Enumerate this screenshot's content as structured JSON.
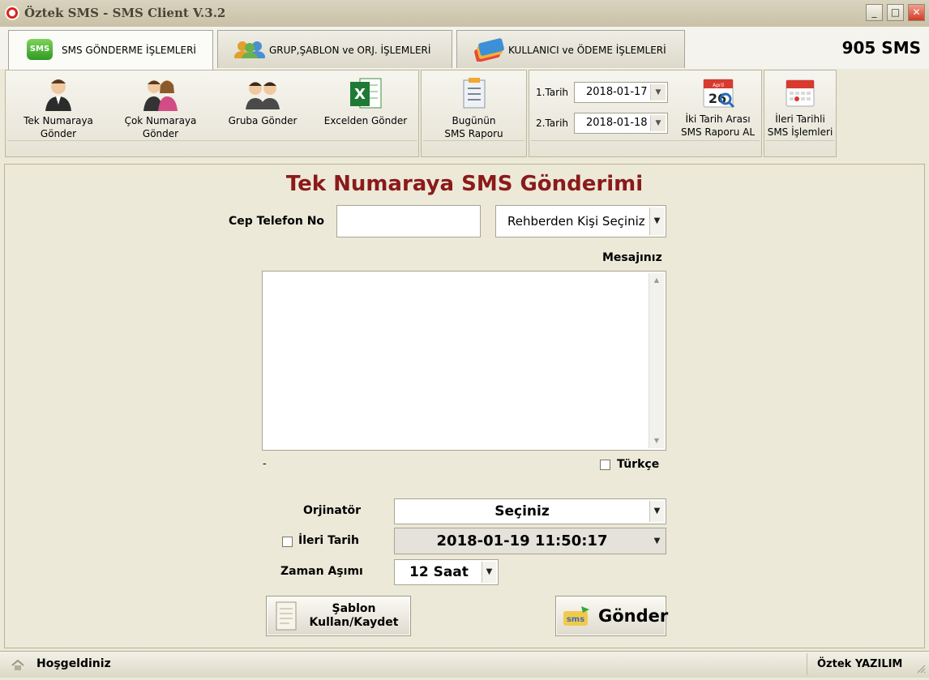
{
  "window": {
    "title": "Öztek SMS - SMS Client  V.3.2",
    "minimize": "_",
    "maximize": "□",
    "close": "✕"
  },
  "tabs": [
    {
      "label": "SMS GÖNDERME İŞLEMLERİ",
      "icon": "sms-bubble-icon"
    },
    {
      "label": "GRUP,ŞABLON ve ORJ. İŞLEMLERİ",
      "icon": "users-group-icon"
    },
    {
      "label": "KULLANICI ve ÖDEME İŞLEMLERİ",
      "icon": "credit-cards-icon"
    }
  ],
  "sms_balance": "905 SMS",
  "ribbon": {
    "send_buttons": [
      {
        "line1": "Tek Numaraya",
        "line2": "Gönder"
      },
      {
        "line1": "Çok Numaraya",
        "line2": "Gönder"
      },
      {
        "line1": "Gruba Gönder",
        "line2": ""
      },
      {
        "line1": "Excelden Gönder",
        "line2": ""
      }
    ],
    "today_report": {
      "line1": "Bugünün",
      "line2": "SMS Raporu"
    },
    "date1_label": "1.Tarih",
    "date1_value": "2018-01-17",
    "date2_label": "2.Tarih",
    "date2_value": "2018-01-18",
    "range_report": {
      "line1": "İki Tarih Arası",
      "line2": "SMS Raporu AL",
      "calendar_day": "26",
      "calendar_month": "April"
    },
    "scheduled": {
      "line1": "İleri Tarihli",
      "line2": "SMS İşlemleri"
    }
  },
  "form": {
    "title": "Tek Numaraya SMS Gönderimi",
    "phone_label": "Cep Telefon No",
    "phone_value": "",
    "contact_select": "Rehberden Kişi Seçiniz",
    "message_label": "Mesajınız",
    "message_value": "",
    "char_counter": "-",
    "turkish_label": "Türkçe",
    "turkish_checked": false,
    "originator_label": "Orjinatör",
    "originator_value": "Seçiniz",
    "future_date_label": "İleri Tarih",
    "future_date_checked": false,
    "future_date_value": "2018-01-19 11:50:17",
    "timeout_label": "Zaman Aşımı",
    "timeout_value": "12 Saat",
    "template_button": {
      "line1": "Şablon",
      "line2": "Kullan/Kaydet"
    },
    "send_button": "Gönder",
    "send_icon_text": "sms"
  },
  "status": {
    "welcome": "Hoşgeldiniz",
    "company": "Öztek YAZILIM"
  },
  "colors": {
    "title_red": "#8b1a1a",
    "window_bg": "#ece9d8",
    "close_red": "#d03b24"
  }
}
